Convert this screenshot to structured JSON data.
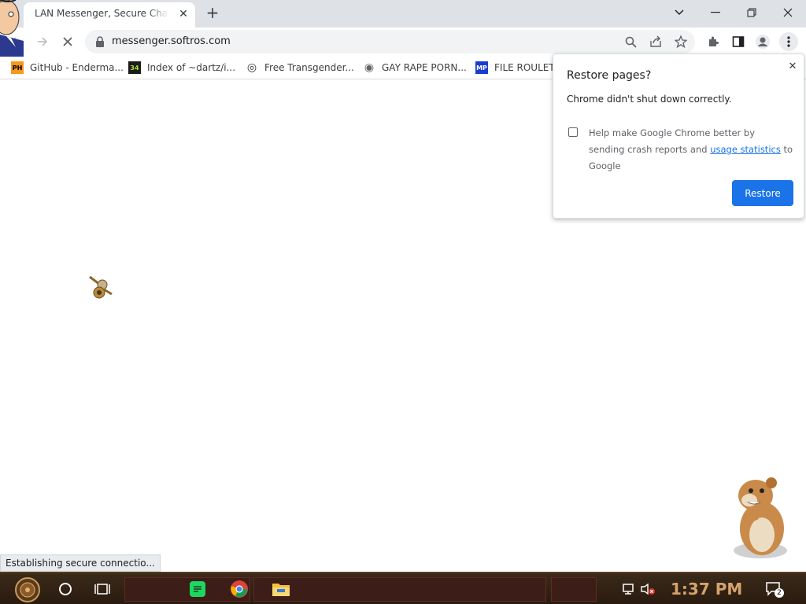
{
  "tab": {
    "title": "LAN Messenger, Secure Chat - Softros",
    "close": "✕"
  },
  "newtab": "+",
  "window": {
    "minimize": "—",
    "restore": "❐",
    "close": "✕",
    "tabsearch": "⌄"
  },
  "omnibox": {
    "url": "messenger.softros.com"
  },
  "bookmarks": [
    {
      "label": "GitHub - Enderma...",
      "icon": "PH",
      "icon_bg": "#f7971e",
      "icon_fg": "#000000"
    },
    {
      "label": "Index of ~dartz/i...",
      "icon": "34",
      "icon_bg": "#1b1b1b",
      "icon_fg": "#a6e22e"
    },
    {
      "label": "Free Transgender...",
      "icon": "◎",
      "icon_bg": "#ffffff",
      "icon_fg": "#333333"
    },
    {
      "label": "GAY RAPE PORN...",
      "icon": "◉",
      "icon_bg": "#ffffff",
      "icon_fg": "#5f6368"
    },
    {
      "label": "FILE ROULETTE",
      "icon": "MP",
      "icon_bg": "#1a3bd1",
      "icon_fg": "#ffffff"
    }
  ],
  "popup": {
    "title": "Restore pages?",
    "message": "Chrome didn't shut down correctly.",
    "checkbox_text_1": "Help make Google Chrome better by sending crash reports and",
    "checkbox_link": "usage statistics",
    "checkbox_text_2": "to Google",
    "restore_label": "Restore",
    "close": "✕"
  },
  "status": {
    "text": "Establishing secure connectio..."
  },
  "taskbar": {
    "clock": "1:37 PM",
    "notification_count": "2"
  },
  "colors": {
    "accent": "#1a73e8",
    "tabstrip": "#dee1e6",
    "taskbar": "#2a1b10",
    "clock": "#d5a36c"
  }
}
